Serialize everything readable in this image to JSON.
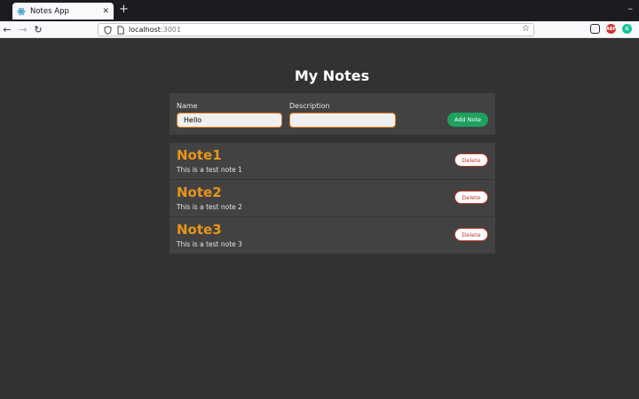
{
  "browser": {
    "tab_title": "Notes App",
    "url_host": "localhost",
    "url_port": ":3001"
  },
  "app": {
    "title": "My Notes",
    "form": {
      "name_label": "Name",
      "name_value": "Hello",
      "description_label": "Description",
      "description_value": "",
      "add_button": "Add Note"
    },
    "notes": [
      {
        "name": "Note1",
        "description": "This is a test note 1",
        "delete_label": "Delete"
      },
      {
        "name": "Note2",
        "description": "This is a test note 2",
        "delete_label": "Delete"
      },
      {
        "name": "Note3",
        "description": "This is a test note 3",
        "delete_label": "Delete"
      }
    ]
  },
  "colors": {
    "background": "#323232",
    "panel": "#424242",
    "accent_orange": "#e6951a",
    "add_green": "#1fa060",
    "delete_red": "#c0392b"
  }
}
